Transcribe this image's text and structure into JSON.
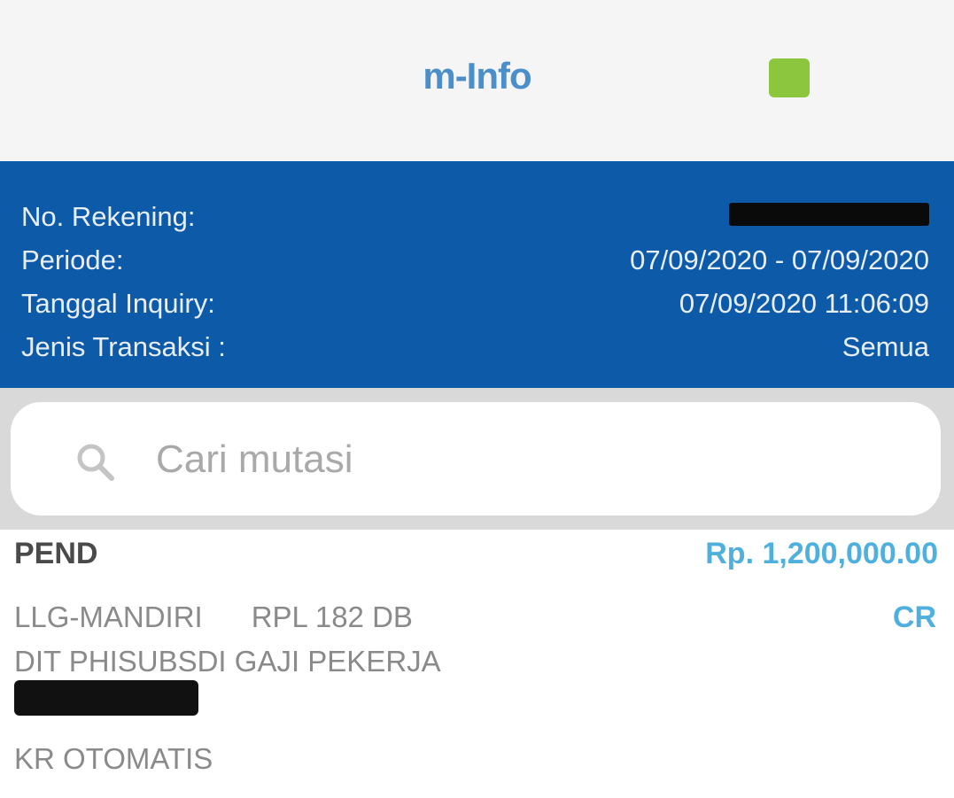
{
  "header": {
    "title": "m-Info",
    "indicator_color": "#8cc63f",
    "background": "#f5f5f5"
  },
  "account_info": {
    "background": "#0d5aa8",
    "rows": [
      {
        "label": "No. Rekening:",
        "value": ""
      },
      {
        "label": "Periode:",
        "value": "07/09/2020 - 07/09/2020"
      },
      {
        "label": "Tanggal Inquiry:",
        "value": "07/09/2020 11:06:09"
      },
      {
        "label": "Jenis Transaksi :",
        "value": "Semua"
      }
    ]
  },
  "search": {
    "placeholder": "Cari mutasi",
    "value": "",
    "icon": "search-icon"
  },
  "transactions": [
    {
      "date": "PEND",
      "amount": "Rp. 1,200,000.00",
      "line1": "LLG-MANDIRI      RPL 182 DB",
      "line2": "DIT PHISUBSDI GAJI PEKERJA",
      "type": "CR",
      "description": "KR OTOMATIS"
    }
  ],
  "colors": {
    "accent": "#4fb0de",
    "title": "#4a8fc9"
  }
}
